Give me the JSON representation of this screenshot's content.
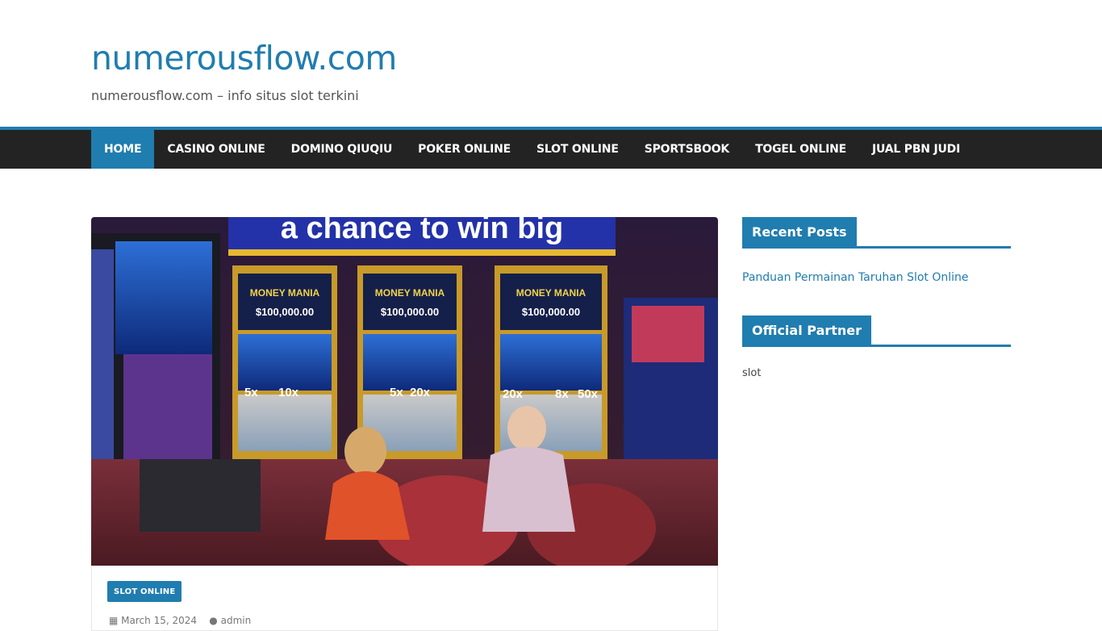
{
  "site": {
    "title": "numerousflow.com",
    "tagline": "numerousflow.com – info situs slot terkini"
  },
  "nav": {
    "items": [
      {
        "label": "HOME",
        "active": true
      },
      {
        "label": "CASINO ONLINE"
      },
      {
        "label": "DOMINO QIUQIU"
      },
      {
        "label": "POKER ONLINE"
      },
      {
        "label": "SLOT ONLINE"
      },
      {
        "label": "SPORTSBOOK"
      },
      {
        "label": "TOGEL ONLINE"
      },
      {
        "label": "JUAL PBN JUDI"
      }
    ]
  },
  "article": {
    "image_banner_text": "a chance to win big",
    "machine_brand": "MONEY MANIA",
    "jackpot": "$100,000.00",
    "multipliers": [
      "5x",
      "10x",
      "5x",
      "20x",
      "20x",
      "8x",
      "50x"
    ],
    "category": "SLOT ONLINE",
    "date": "March 15, 2024",
    "author": "admin"
  },
  "sidebar": {
    "recent_posts": {
      "title": "Recent Posts",
      "items": [
        "Panduan Permainan Taruhan Slot Online"
      ]
    },
    "official_partner": {
      "title": "Official Partner",
      "text": "slot"
    }
  },
  "colors": {
    "accent": "#207daf",
    "nav_bg": "#232323"
  }
}
